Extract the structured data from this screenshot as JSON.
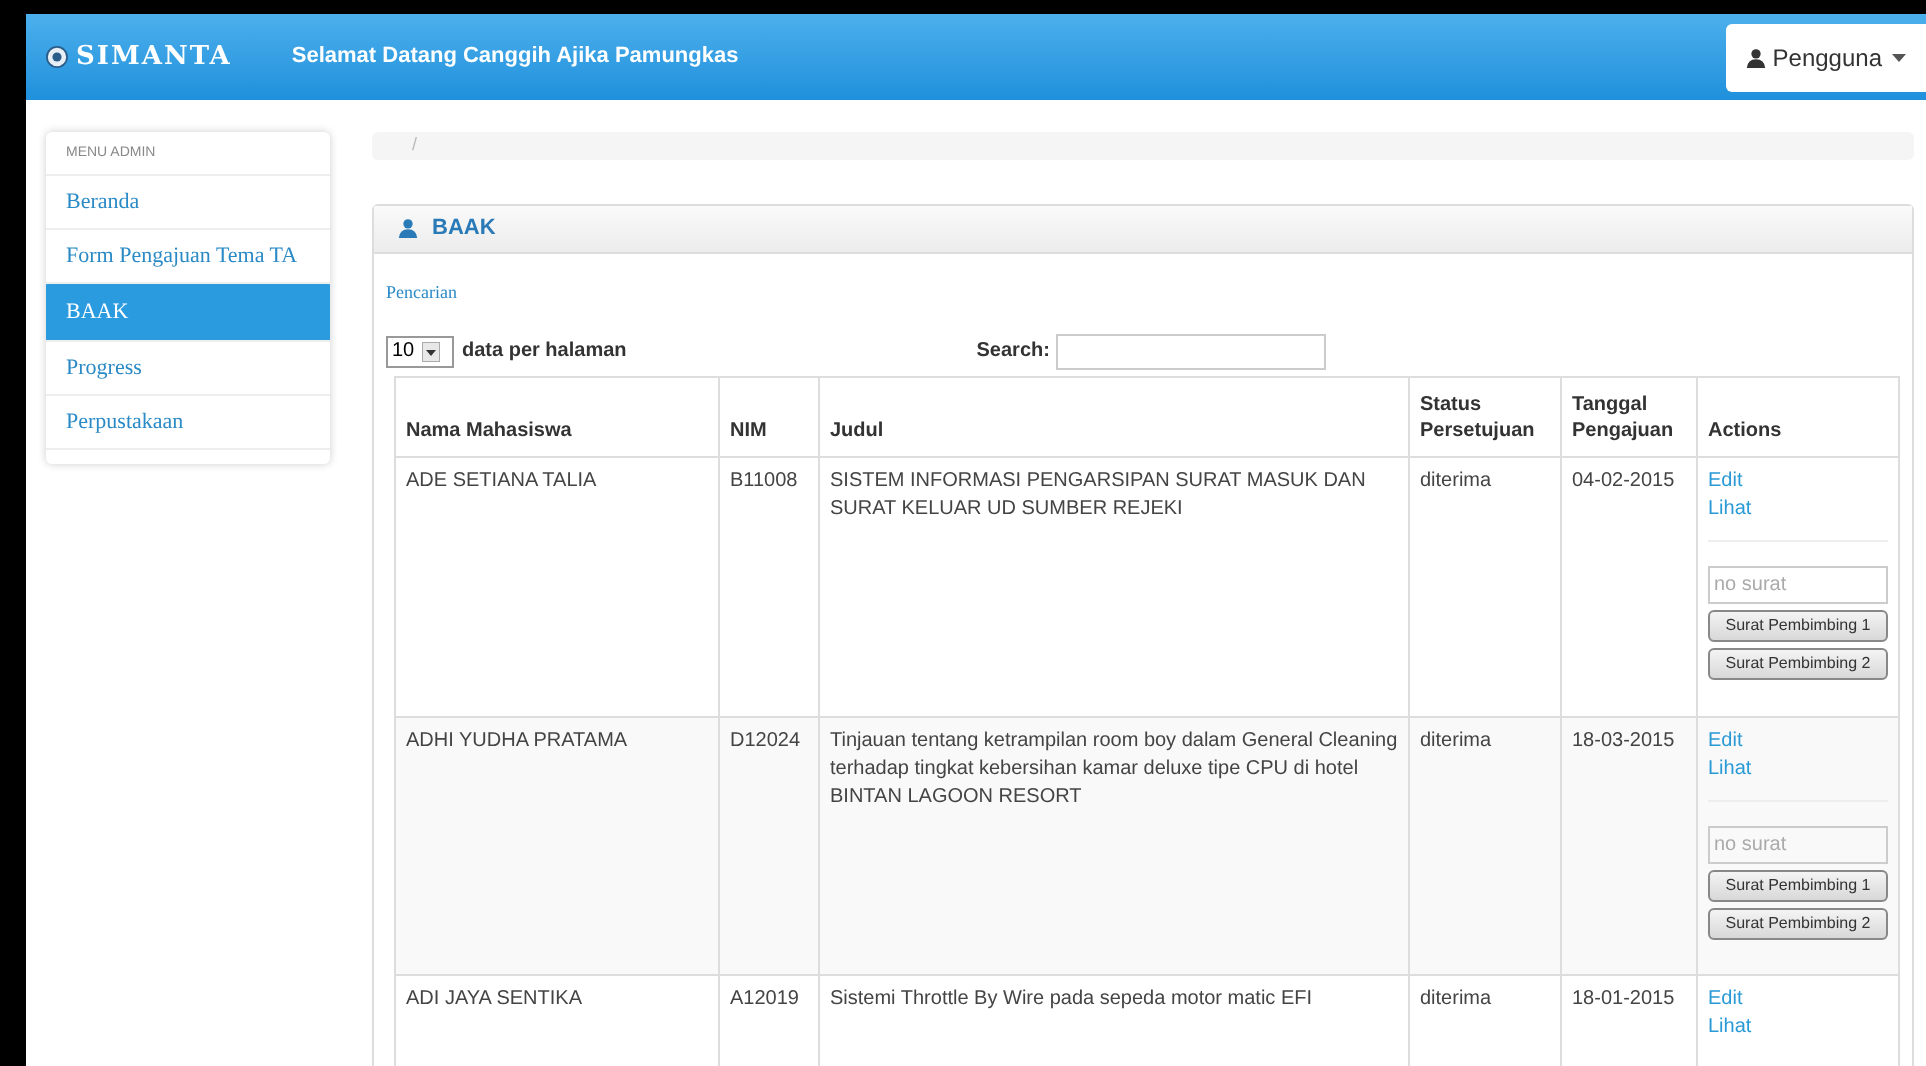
{
  "navbar": {
    "brand": "SIMANTA",
    "welcome": "Selamat Datang Canggih Ajika Pamungkas",
    "user_menu": "Pengguna"
  },
  "sidebar": {
    "heading": "MENU ADMIN",
    "items": [
      {
        "label": "Beranda",
        "selected": false
      },
      {
        "label": "Form Pengajuan Tema TA",
        "selected": false
      },
      {
        "label": "BAAK",
        "selected": true
      },
      {
        "label": "Progress",
        "selected": false
      },
      {
        "label": "Perpustakaan",
        "selected": false
      }
    ]
  },
  "breadcrumb": "/",
  "panel": {
    "title": "BAAK",
    "search_link": "Pencarian",
    "page_size": "10",
    "page_size_label": "data per halaman",
    "search_label": "Search:"
  },
  "table": {
    "columns": [
      "Nama Mahasiswa",
      "NIM",
      "Judul",
      "Status Persetujuan",
      "Tanggal Pengajuan",
      "Actions"
    ],
    "rows": [
      {
        "nama": "ADE SETIANA TALIA",
        "nim": "B11008",
        "judul": "SISTEM INFORMASI PENGARSIPAN SURAT MASUK DAN SURAT KELUAR UD SUMBER REJEKI",
        "status": "diterima",
        "tanggal": "04-02-2015",
        "edit": "Edit",
        "lihat": "Lihat",
        "placeholder": "no surat",
        "buttons": [
          "Surat Pembimbing 1",
          "Surat Pembimbing 2"
        ]
      },
      {
        "nama": "ADHI YUDHA PRATAMA",
        "nim": "D12024",
        "judul": "Tinjauan tentang ketrampilan room boy dalam General Cleaning terhadap tingkat kebersihan kamar deluxe tipe CPU di hotel BINTAN LAGOON RESORT",
        "status": "diterima",
        "tanggal": "18-03-2015",
        "edit": "Edit",
        "lihat": "Lihat",
        "placeholder": "no surat",
        "buttons": [
          "Surat Pembimbing 1",
          "Surat Pembimbing 2"
        ]
      },
      {
        "nama": "ADI JAYA SENTIKA",
        "nim": "A12019",
        "judul": "Sistemi Throttle By Wire pada sepeda motor matic EFI",
        "status": "diterima",
        "tanggal": "18-01-2015",
        "edit": "Edit",
        "lihat": "Lihat"
      }
    ]
  }
}
